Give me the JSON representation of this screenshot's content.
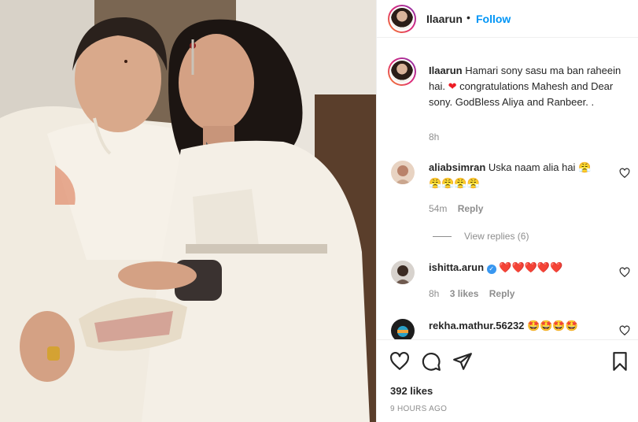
{
  "post": {
    "username": "Ilaarun",
    "dot": "•",
    "follow_label": "Follow",
    "caption": "Hamari sony sasu ma ban raheein hai. ❤️ congratulations Mahesh and Dear sony. GodBless Aliya and Ranbeer. .",
    "caption_before_heart": "Hamari sony sasu ma ban raheein hai.",
    "caption_after_heart": "congratulations Mahesh and Dear sony. GodBless Aliya and Ranbeer. .",
    "caption_time": "8h",
    "likes": "392 likes",
    "time_ago": "9 HOURS AGO"
  },
  "comments": [
    {
      "username": "aliabsimran",
      "text": "Uska naam alia hai 😤",
      "emoji_line": "😤😤😤😤",
      "time": "54m",
      "reply_label": "Reply"
    },
    {
      "view_replies": "View replies (6)"
    },
    {
      "username": "ishitta.arun",
      "text": "❤️❤️❤️❤️❤️",
      "time": "8h",
      "likes": "3 likes",
      "reply_label": "Reply"
    },
    {
      "username": "rekha.mathur.56232",
      "text": "🤩🤩🤩🤩"
    }
  ],
  "icons": {
    "like": "heart-outline-icon",
    "comment": "speech-bubble-icon",
    "share": "paper-plane-icon",
    "save": "bookmark-icon"
  },
  "colors": {
    "follow": "#0095f6",
    "heart": "#ed1c24",
    "verified": "#3897f0"
  }
}
